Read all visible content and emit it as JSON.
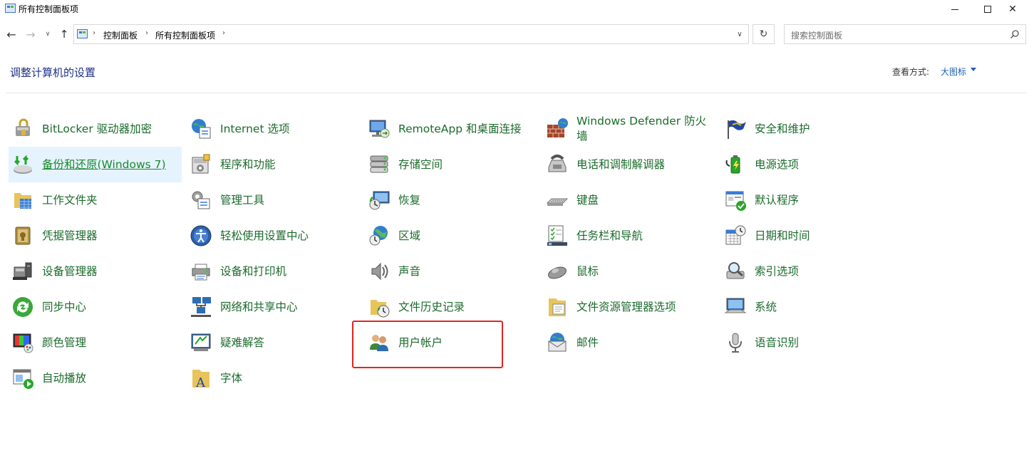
{
  "window": {
    "title": "所有控制面板项"
  },
  "address": {
    "crumbs": [
      "控制面板",
      "所有控制面板项"
    ],
    "search_placeholder": "搜索控制面板"
  },
  "header": {
    "title": "调整计算机的设置",
    "view_by_label": "查看方式:",
    "view_by_value": "大图标"
  },
  "items": [
    {
      "label": "BitLocker 驱动器加密",
      "icon": "bitlocker-icon"
    },
    {
      "label": "Internet 选项",
      "icon": "internet-options-icon"
    },
    {
      "label": "RemoteApp 和桌面连接",
      "icon": "remoteapp-icon"
    },
    {
      "label": "Windows Defender 防火墙",
      "icon": "firewall-icon"
    },
    {
      "label": "安全和维护",
      "icon": "security-maintenance-icon"
    },
    {
      "label": "备份和还原(Windows 7)",
      "icon": "backup-restore-icon"
    },
    {
      "label": "程序和功能",
      "icon": "programs-features-icon"
    },
    {
      "label": "存储空间",
      "icon": "storage-spaces-icon"
    },
    {
      "label": "电话和调制解调器",
      "icon": "phone-modem-icon"
    },
    {
      "label": "电源选项",
      "icon": "power-options-icon"
    },
    {
      "label": "工作文件夹",
      "icon": "work-folders-icon"
    },
    {
      "label": "管理工具",
      "icon": "admin-tools-icon"
    },
    {
      "label": "恢复",
      "icon": "recovery-icon"
    },
    {
      "label": "键盘",
      "icon": "keyboard-icon"
    },
    {
      "label": "默认程序",
      "icon": "default-programs-icon"
    },
    {
      "label": "凭据管理器",
      "icon": "credential-manager-icon"
    },
    {
      "label": "轻松使用设置中心",
      "icon": "ease-of-access-icon"
    },
    {
      "label": "区域",
      "icon": "region-icon"
    },
    {
      "label": "任务栏和导航",
      "icon": "taskbar-navigation-icon"
    },
    {
      "label": "日期和时间",
      "icon": "date-time-icon"
    },
    {
      "label": "设备管理器",
      "icon": "device-manager-icon"
    },
    {
      "label": "设备和打印机",
      "icon": "devices-printers-icon"
    },
    {
      "label": "声音",
      "icon": "sound-icon"
    },
    {
      "label": "鼠标",
      "icon": "mouse-icon"
    },
    {
      "label": "索引选项",
      "icon": "indexing-options-icon"
    },
    {
      "label": "同步中心",
      "icon": "sync-center-icon"
    },
    {
      "label": "网络和共享中心",
      "icon": "network-sharing-icon"
    },
    {
      "label": "文件历史记录",
      "icon": "file-history-icon"
    },
    {
      "label": "文件资源管理器选项",
      "icon": "explorer-options-icon"
    },
    {
      "label": "系统",
      "icon": "system-icon"
    },
    {
      "label": "颜色管理",
      "icon": "color-management-icon"
    },
    {
      "label": "疑难解答",
      "icon": "troubleshooting-icon"
    },
    {
      "label": "用户帐户",
      "icon": "user-accounts-icon"
    },
    {
      "label": "邮件",
      "icon": "mail-icon"
    },
    {
      "label": "语音识别",
      "icon": "speech-recognition-icon"
    },
    {
      "label": "自动播放",
      "icon": "autoplay-icon"
    },
    {
      "label": "字体",
      "icon": "fonts-icon"
    }
  ],
  "selected_item": "备份和还原(Windows 7)",
  "highlighted_item": "用户帐户",
  "colors": {
    "link_green": "#1b6b2c",
    "title_blue": "#1e3287",
    "selection_bg": "#e5f3ff",
    "highlight_red": "#e0261f"
  }
}
